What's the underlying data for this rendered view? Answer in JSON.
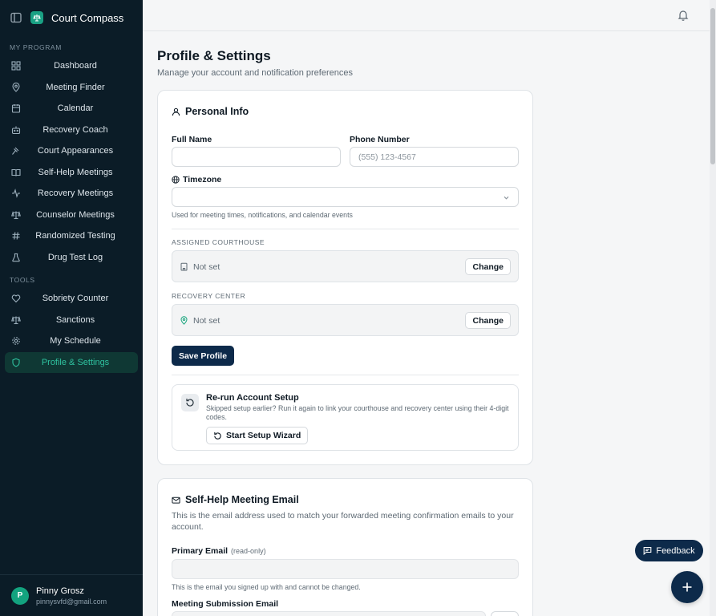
{
  "sidebar": {
    "brand": "Court Compass",
    "sections": [
      {
        "label": "My Program"
      },
      {
        "label": "Tools"
      }
    ],
    "program_items": [
      {
        "label": "Dashboard",
        "icon": "grid-icon"
      },
      {
        "label": "Meeting Finder",
        "icon": "map-pin-icon"
      },
      {
        "label": "Calendar",
        "icon": "calendar-icon"
      },
      {
        "label": "Recovery Coach",
        "icon": "bot-icon"
      },
      {
        "label": "Court Appearances",
        "icon": "gavel-icon"
      },
      {
        "label": "Self-Help Meetings",
        "icon": "book-icon"
      },
      {
        "label": "Recovery Meetings",
        "icon": "activity-icon"
      },
      {
        "label": "Counselor Meetings",
        "icon": "scale-icon"
      },
      {
        "label": "Randomized Testing",
        "icon": "hash-icon"
      },
      {
        "label": "Drug Test Log",
        "icon": "flask-icon"
      }
    ],
    "tool_items": [
      {
        "label": "Sobriety Counter",
        "icon": "heart-icon"
      },
      {
        "label": "Sanctions",
        "icon": "scale-icon"
      },
      {
        "label": "My Schedule",
        "icon": "gear-icon"
      },
      {
        "label": "Profile & Settings",
        "icon": "shield-icon",
        "active": true
      }
    ],
    "user": {
      "initial": "P",
      "name": "Pinny Grosz",
      "email": "pinnysvfd@gmail.com"
    }
  },
  "page": {
    "title": "Profile & Settings",
    "subtitle": "Manage your account and notification preferences"
  },
  "personal": {
    "title": "Personal Info",
    "full_name_label": "Full Name",
    "full_name_value": "",
    "phone_label": "Phone Number",
    "phone_placeholder": "(555) 123-4567",
    "timezone_label": "Timezone",
    "timezone_hint": "Used for meeting times, notifications, and calendar events",
    "courthouse_label": "Assigned Courthouse",
    "courthouse_value": "Not set",
    "recovery_label": "Recovery Center",
    "recovery_value": "Not set",
    "change_label": "Change",
    "save_label": "Save Profile",
    "setup_title": "Re-run Account Setup",
    "setup_desc": "Skipped setup earlier? Run it again to link your courthouse and recovery center using their 4-digit codes.",
    "setup_button": "Start Setup Wizard"
  },
  "email": {
    "title": "Self-Help Meeting Email",
    "desc": "This is the email address used to match your forwarded meeting confirmation emails to your account.",
    "primary_label": "Primary Email",
    "readonly_tag": "(read-only)",
    "primary_hint": "This is the email you signed up with and cannot be changed.",
    "submission_label": "Meeting Submission Email"
  },
  "floating": {
    "feedback_label": "Feedback"
  },
  "colors": {
    "sidebar_bg": "#0b1c27",
    "accent": "#2fc3a0",
    "primary": "#0d2a4a"
  }
}
